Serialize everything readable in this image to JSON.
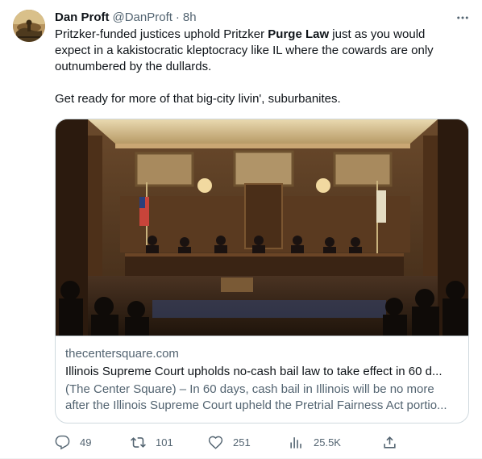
{
  "author": {
    "display_name": "Dan Proft",
    "handle": "@DanProft",
    "separator": "·",
    "time": "8h"
  },
  "tweet": {
    "text_before_bold": "Pritzker-funded justices uphold Pritzker ",
    "text_bold": "Purge Law",
    "text_after_bold": " just as you would expect in a kakistocratic kleptocracy like IL where the cowards are only outnumbered by the dullards.",
    "text_second_paragraph": "Get ready for more of that big-city livin', suburbanites."
  },
  "card": {
    "domain": "thecentersquare.com",
    "title": "Illinois Supreme Court upholds no-cash bail law to take effect in 60 d...",
    "description": "(The Center Square) – In 60 days, cash bail in Illinois will be no more after the Illinois Supreme Court upheld the Pretrial Fairness Act portio..."
  },
  "actions": {
    "replies": "49",
    "retweets": "101",
    "likes": "251",
    "views": "25.5K"
  },
  "icons": {
    "more": "more-icon",
    "reply": "reply-icon",
    "retweet": "retweet-icon",
    "like": "heart-icon",
    "views": "views-icon",
    "share": "share-icon"
  },
  "colors": {
    "text_primary": "#0f1419",
    "text_secondary": "#536471",
    "border": "#cfd9de"
  }
}
